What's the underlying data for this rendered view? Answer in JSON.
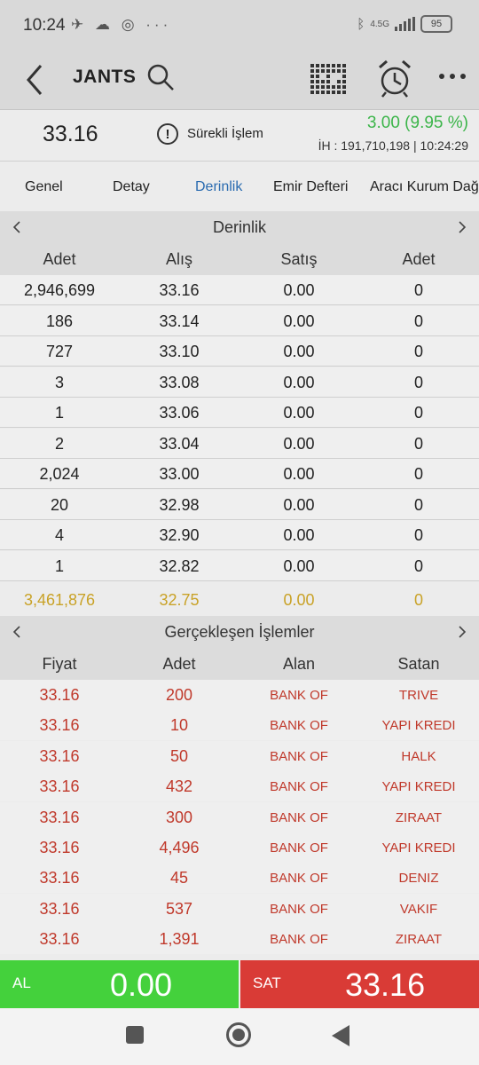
{
  "status_bar": {
    "time": "10:24",
    "battery": "95",
    "network": "4.5G"
  },
  "header": {
    "symbol": "JANTS"
  },
  "price_header": {
    "last_price": "33.16",
    "continuous_label": "Sürekli İşlem",
    "change": "3.00 (9.95 %)",
    "volume_line": "İH : 191,710,198  |  10:24:29"
  },
  "tabs": [
    {
      "label": "Genel"
    },
    {
      "label": "Detay"
    },
    {
      "label": "Derinlik",
      "active": true
    },
    {
      "label": "Emir Defteri"
    },
    {
      "label": "Aracı Kurum Dağ"
    }
  ],
  "depth": {
    "title": "Derinlik",
    "columns": [
      "Adet",
      "Alış",
      "Satış",
      "Adet"
    ],
    "rows": [
      [
        "2,946,699",
        "33.16",
        "0.00",
        "0"
      ],
      [
        "186",
        "33.14",
        "0.00",
        "0"
      ],
      [
        "727",
        "33.10",
        "0.00",
        "0"
      ],
      [
        "3",
        "33.08",
        "0.00",
        "0"
      ],
      [
        "1",
        "33.06",
        "0.00",
        "0"
      ],
      [
        "2",
        "33.04",
        "0.00",
        "0"
      ],
      [
        "2,024",
        "33.00",
        "0.00",
        "0"
      ],
      [
        "20",
        "32.98",
        "0.00",
        "0"
      ],
      [
        "4",
        "32.90",
        "0.00",
        "0"
      ],
      [
        "1",
        "32.82",
        "0.00",
        "0"
      ]
    ],
    "total": [
      "3,461,876",
      "32.75",
      "0.00",
      "0"
    ]
  },
  "trades": {
    "title": "Gerçekleşen İşlemler",
    "columns": [
      "Fiyat",
      "Adet",
      "Alan",
      "Satan"
    ],
    "rows": [
      [
        "33.16",
        "200",
        "BANK OF",
        "TRIVE"
      ],
      [
        "33.16",
        "10",
        "BANK OF",
        "YAPI KREDI"
      ],
      [
        "33.16",
        "50",
        "BANK OF",
        "HALK"
      ],
      [
        "33.16",
        "432",
        "BANK OF",
        "YAPI KREDI"
      ],
      [
        "33.16",
        "300",
        "BANK OF",
        "ZIRAAT"
      ],
      [
        "33.16",
        "4,496",
        "BANK OF",
        "YAPI KREDI"
      ],
      [
        "33.16",
        "45",
        "BANK OF",
        "DENIZ"
      ],
      [
        "33.16",
        "537",
        "BANK OF",
        "VAKIF"
      ],
      [
        "33.16",
        "1,391",
        "BANK OF",
        "ZIRAAT"
      ]
    ]
  },
  "actions": {
    "buy_label": "AL",
    "buy_value": "0.00",
    "sell_label": "SAT",
    "sell_value": "33.16"
  },
  "colors": {
    "positive": "#3cb54a",
    "buy": "#44d13c",
    "sell": "#d93b36",
    "trade_text": "#c0392b",
    "total_text": "#c9a227",
    "active_tab": "#2a6bb0"
  }
}
